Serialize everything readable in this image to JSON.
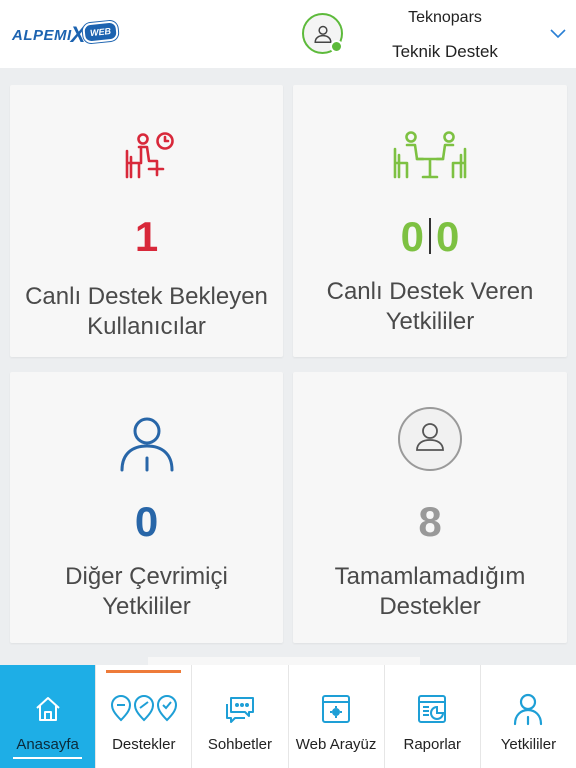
{
  "header": {
    "logo_text": "ALPEMI",
    "logo_x": "X",
    "logo_badge": "WEB",
    "org_name": "Teknopars",
    "user_name": "Teknik Destek",
    "status_color": "#5dba3b",
    "dropdown_icon": "chevron-down-icon"
  },
  "cards": {
    "waiting": {
      "count": "1",
      "label_line1": "Canlı Destek Bekleyen",
      "label_line2": "Kullanıcılar",
      "color": "#d8283a",
      "icon": "waiting-user-clock-icon"
    },
    "serving": {
      "count_a": "0",
      "count_b": "0",
      "label_line1": "Canlı Destek Veren",
      "label_line2": "Yetkililer",
      "color": "#7dc142",
      "icon": "meeting-table-icon"
    },
    "others": {
      "count": "0",
      "label_line1": "Diğer Çevrimiçi",
      "label_line2": "Yetkililer",
      "color": "#2866a8",
      "icon": "person-outline-icon"
    },
    "unfinished": {
      "count": "8",
      "label_line1": "Tamamlamadığım",
      "label_line2": "Destekler",
      "color": "#999999",
      "icon": "person-circle-icon"
    }
  },
  "nav": [
    {
      "label": "Anasayfa",
      "icon": "home-icon",
      "active": true
    },
    {
      "label": "Destekler",
      "icon": "support-pins-icon",
      "active": false
    },
    {
      "label": "Sohbetler",
      "icon": "chat-bubbles-icon",
      "active": false
    },
    {
      "label": "Web Arayüz",
      "icon": "browser-gear-icon",
      "active": false
    },
    {
      "label": "Raporlar",
      "icon": "report-chart-icon",
      "active": false
    },
    {
      "label": "Yetkililer",
      "icon": "user-icon",
      "active": false
    }
  ],
  "colors": {
    "accent": "#1eaee6",
    "orange": "#ee7b39",
    "icon_blue": "#1e9fd6"
  }
}
